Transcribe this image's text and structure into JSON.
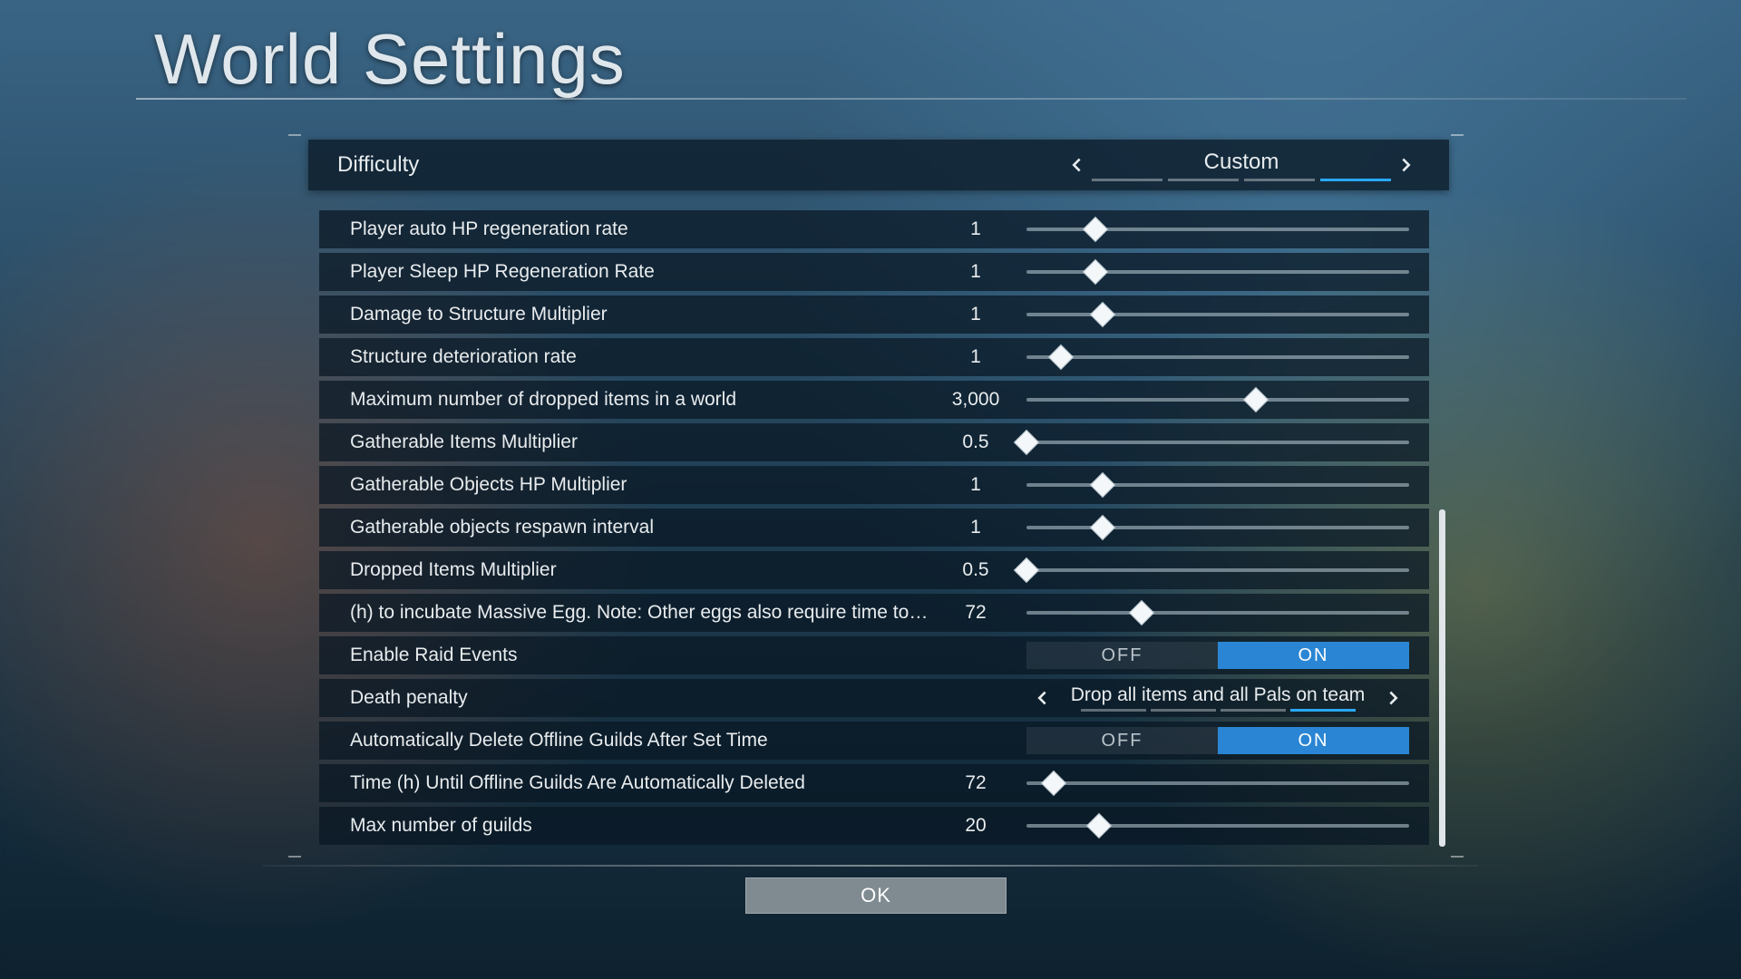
{
  "title": "World Settings",
  "difficulty": {
    "label": "Difficulty",
    "value": "Custom",
    "options_count": 4,
    "active_index": 3
  },
  "ok_label": "OK",
  "toggle_labels": {
    "off": "OFF",
    "on": "ON"
  },
  "rows": [
    {
      "id": "player-auto-hp-regen",
      "kind": "slider",
      "label": "Player auto HP regeneration rate",
      "value": "1",
      "pos": 0.18
    },
    {
      "id": "player-sleep-hp-regen",
      "kind": "slider",
      "label": "Player Sleep HP Regeneration Rate",
      "value": "1",
      "pos": 0.18
    },
    {
      "id": "damage-to-structure",
      "kind": "slider",
      "label": "Damage to Structure Multiplier",
      "value": "1",
      "pos": 0.2
    },
    {
      "id": "structure-deterioration",
      "kind": "slider",
      "label": "Structure deterioration rate",
      "value": "1",
      "pos": 0.09
    },
    {
      "id": "max-dropped-items",
      "kind": "slider",
      "label": "Maximum number of dropped items in a world",
      "value": "3,000",
      "pos": 0.6
    },
    {
      "id": "gatherable-items-mult",
      "kind": "slider",
      "label": "Gatherable Items Multiplier",
      "value": "0.5",
      "pos": 0.0
    },
    {
      "id": "gatherable-hp-mult",
      "kind": "slider",
      "label": "Gatherable Objects HP Multiplier",
      "value": "1",
      "pos": 0.2
    },
    {
      "id": "gatherable-respawn",
      "kind": "slider",
      "label": "Gatherable objects respawn interval",
      "value": "1",
      "pos": 0.2
    },
    {
      "id": "dropped-items-mult",
      "kind": "slider",
      "label": "Dropped Items Multiplier",
      "value": "0.5",
      "pos": 0.0
    },
    {
      "id": "incubate-massive-egg",
      "kind": "slider",
      "label": "(h) to incubate Massive Egg. Note: Other eggs also require time to incubate.",
      "value": "72",
      "pos": 0.3
    },
    {
      "id": "enable-raid-events",
      "kind": "toggle",
      "label": "Enable Raid Events",
      "value": "ON"
    },
    {
      "id": "death-penalty",
      "kind": "select",
      "label": "Death penalty",
      "value": "Drop all items and all Pals on team",
      "options_count": 4,
      "active_index": 3
    },
    {
      "id": "auto-delete-offline",
      "kind": "toggle",
      "label": "Automatically Delete Offline Guilds After Set Time",
      "value": "ON"
    },
    {
      "id": "offline-guild-delete-h",
      "kind": "slider",
      "label": "Time (h) Until Offline Guilds Are Automatically Deleted",
      "value": "72",
      "pos": 0.07
    },
    {
      "id": "max-guilds",
      "kind": "slider",
      "label": "Max number of guilds",
      "value": "20",
      "pos": 0.19
    }
  ]
}
